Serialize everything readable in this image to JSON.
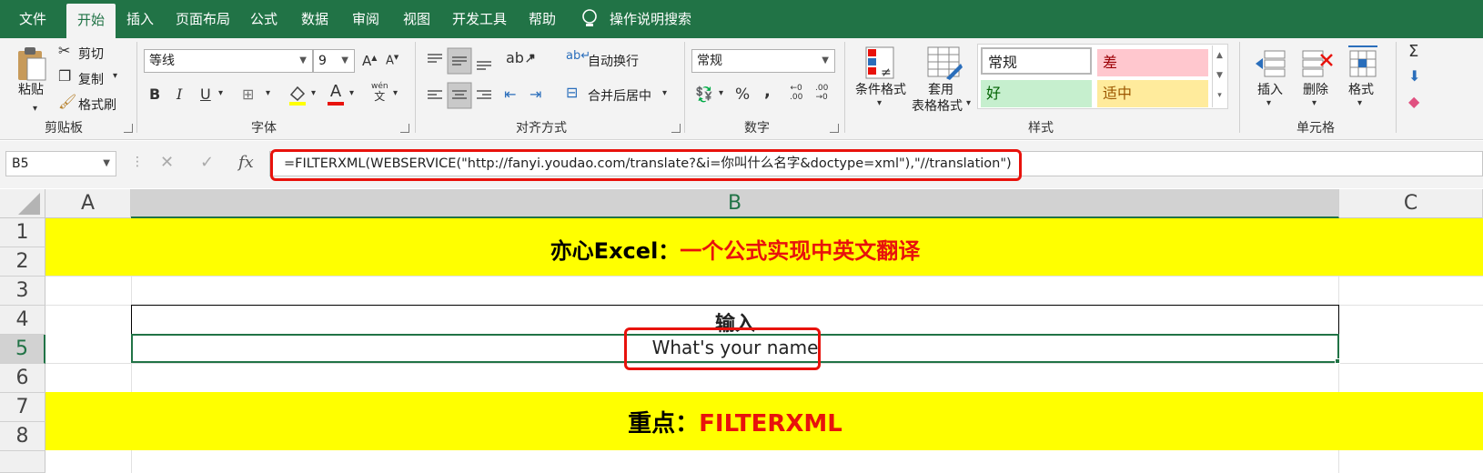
{
  "menu": {
    "tabs": [
      "文件",
      "开始",
      "插入",
      "页面布局",
      "公式",
      "数据",
      "审阅",
      "视图",
      "开发工具",
      "帮助"
    ],
    "search_label": "操作说明搜索"
  },
  "ribbon": {
    "clipboard": {
      "paste": "粘贴",
      "cut": "剪切",
      "copy": "复制",
      "format_painter": "格式刷",
      "group": "剪贴板"
    },
    "font": {
      "name": "等线",
      "size": "9",
      "bold": "B",
      "italic": "I",
      "underline": "U",
      "wen": "wén",
      "wen2": "文",
      "group": "字体"
    },
    "alignment": {
      "wrap": "自动换行",
      "merge": "合并后居中",
      "group": "对齐方式"
    },
    "number": {
      "format": "常规",
      "percent": "%",
      "comma": ",",
      "group": "数字"
    },
    "styles": {
      "cond_format": "条件格式",
      "table_format_1": "套用",
      "table_format_2": "表格格式",
      "normal": "常规",
      "bad": "差",
      "good": "好",
      "neutral": "适中",
      "group": "样式"
    },
    "cells": {
      "insert": "插入",
      "delete": "删除",
      "format": "格式",
      "group": "单元格"
    }
  },
  "formula_bar": {
    "name_box": "B5",
    "fx": "fx",
    "formula": "=FILTERXML(WEBSERVICE(\"http://fanyi.youdao.com/translate?&i=你叫什么名字&doctype=xml\"),\"//translation\")"
  },
  "grid": {
    "columns": [
      "A",
      "B",
      "C"
    ],
    "rows": [
      "1",
      "2",
      "3",
      "4",
      "5",
      "6",
      "7",
      "8"
    ],
    "title_black": "亦心Excel：",
    "title_red": "一个公式实现中英文翻译",
    "input_label": "输入",
    "b5_value": "What's your name",
    "key_black": "重点：",
    "key_red": "FILTERXML"
  },
  "colors": {
    "excel_green": "#217346",
    "highlight_yellow": "#ffff00",
    "emphasis_red": "#e8120c"
  }
}
